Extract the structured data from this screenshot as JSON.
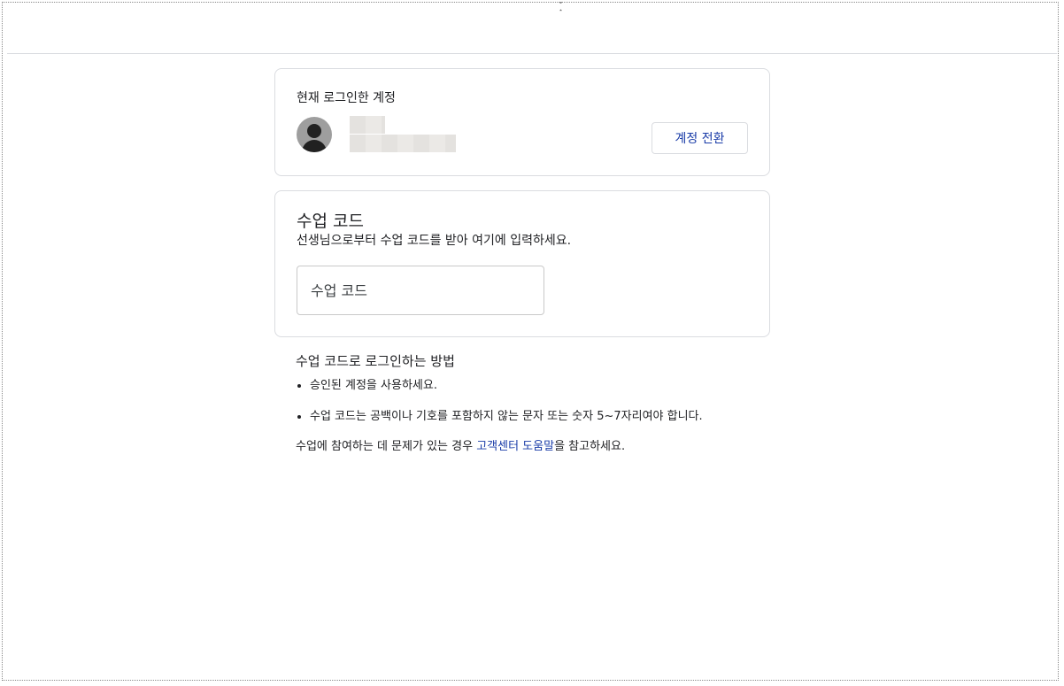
{
  "header": {
    "cursor_glyph": "̝̆"
  },
  "account": {
    "heading": "현재 로그인한 계정",
    "switch_label": "계정 전환"
  },
  "class_code": {
    "title": "수업 코드",
    "subtitle": "선생님으로부터 수업 코드를 받아 여기에 입력하세요.",
    "input_placeholder": "수업 코드",
    "input_value": ""
  },
  "help": {
    "title": "수업 코드로 로그인하는 방법",
    "items": [
      "승인된 계정을 사용하세요.",
      "수업 코드는 공백이나 기호를 포함하지 않는 문자 또는 숫자 5~7자리여야 합니다."
    ],
    "footer_prefix": "수업에 참여하는 데 문제가 있는 경우 ",
    "footer_link": "고객센터 도움말",
    "footer_suffix": "을 참고하세요."
  },
  "colors": {
    "accent": "#1a3ca8",
    "border": "#dadce0",
    "text": "#202124"
  },
  "icons": {
    "avatar": "user-avatar-icon"
  }
}
